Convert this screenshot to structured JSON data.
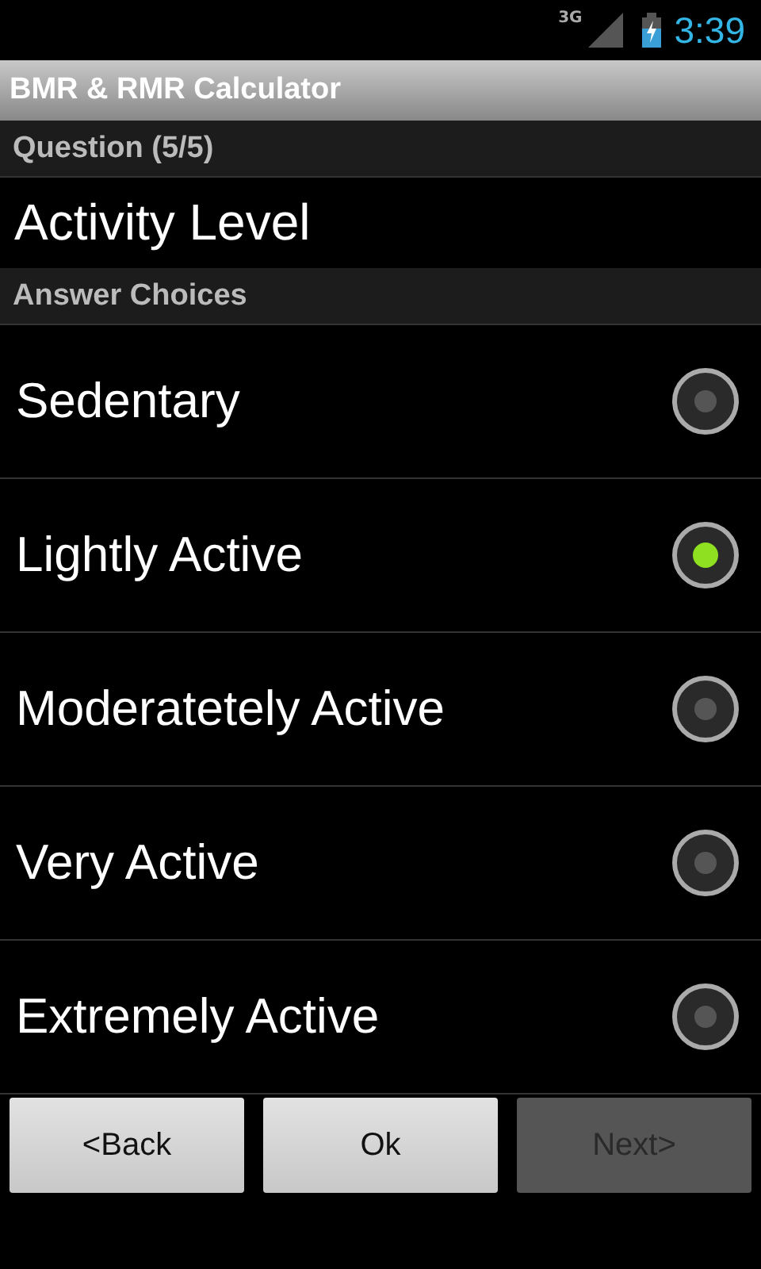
{
  "status_bar": {
    "network": "3G",
    "time": "3:39"
  },
  "window": {
    "title": "BMR & RMR Calculator"
  },
  "question": {
    "header": "Question (5/5)",
    "text": "Activity Level"
  },
  "answers": {
    "header": "Answer Choices",
    "choices": [
      {
        "label": "Sedentary",
        "selected": false
      },
      {
        "label": "Lightly Active",
        "selected": true
      },
      {
        "label": "Moderatetely Active",
        "selected": false
      },
      {
        "label": "Very Active",
        "selected": false
      },
      {
        "label": "Extremely Active",
        "selected": false
      }
    ]
  },
  "buttons": [
    {
      "label": "<Back",
      "disabled": false
    },
    {
      "label": "Ok",
      "disabled": false
    },
    {
      "label": "Next>",
      "disabled": true
    }
  ]
}
